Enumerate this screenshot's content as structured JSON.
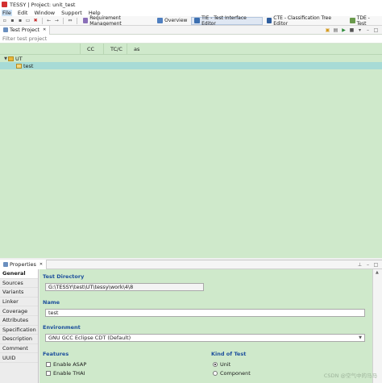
{
  "window": {
    "title": "TESSY | Project: unit_test"
  },
  "menu": [
    "File",
    "Edit",
    "Window",
    "Support",
    "Help"
  ],
  "perspectives": [
    {
      "label": "Requirement Management",
      "icon": "requirement-icon",
      "active": false,
      "color": "#8a6fb8"
    },
    {
      "label": "Overview",
      "icon": "overview-icon",
      "active": false,
      "color": "#4f7fc0"
    },
    {
      "label": "TIE - Test Interface Editor",
      "icon": "tie-icon",
      "active": true,
      "color": "#3c6fb0"
    },
    {
      "label": "CTE - Classification Tree Editor",
      "icon": "cte-icon",
      "active": false,
      "color": "#2f5e9e"
    },
    {
      "label": "TDE - Test",
      "icon": "tde-icon",
      "active": false,
      "color": "#6a9a4c"
    }
  ],
  "project_view": {
    "tab_label": "Test Project",
    "filter_placeholder": "Filter test project",
    "columns": [
      "CC",
      "TC/C",
      "as"
    ],
    "tree": [
      {
        "label": "UT",
        "expanded": true,
        "level": 0
      },
      {
        "label": "test",
        "level": 1,
        "selected": true
      }
    ]
  },
  "properties": {
    "tab_label": "Properties",
    "sidebar": [
      "General",
      "Sources",
      "Variants",
      "Linker",
      "Coverage",
      "Attributes",
      "Specification",
      "Description",
      "Comment",
      "UUID"
    ],
    "active_section": "General",
    "test_directory": {
      "label": "Test Directory",
      "value": "G:\\TESSY\\test\\UT\\tessy\\work\\4\\8"
    },
    "name": {
      "label": "Name",
      "value": "test"
    },
    "environment": {
      "label": "Environment",
      "value": "GNU GCC Eclipse CDT (Default)"
    },
    "features": {
      "label": "Features",
      "options": [
        {
          "label": "Enable ASAP",
          "checked": false
        },
        {
          "label": "Enable THAI",
          "checked": false
        }
      ]
    },
    "kind_of_test": {
      "label": "Kind of Test",
      "options": [
        {
          "label": "Unit",
          "selected": true
        },
        {
          "label": "Component",
          "selected": false
        }
      ]
    }
  },
  "watermark": "CSDN @空气中的马马"
}
